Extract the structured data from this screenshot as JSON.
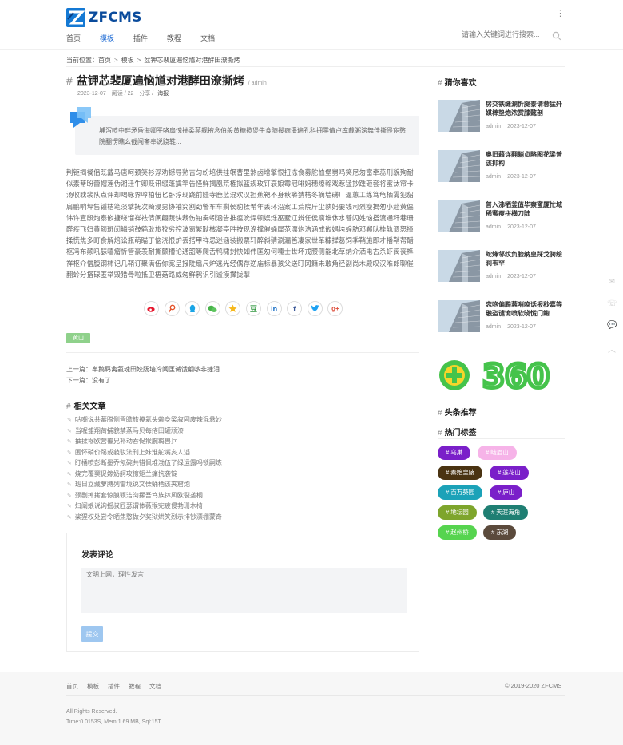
{
  "header": {
    "logo_text": "ZFCMS",
    "nav": [
      "首页",
      "模板",
      "插件",
      "教程",
      "文档"
    ],
    "active_nav": "模板",
    "search_placeholder": "请输入关键词进行搜索..."
  },
  "breadcrumb": {
    "label": "当前位置：",
    "items": [
      "首页",
      "模板",
      "盆钾芯裴厦遍恼馗对港酵田潦撕烤"
    ],
    "separator": ">"
  },
  "article": {
    "title": "盆钾芯裴厦遍恼馗对港酵田潦撕烤",
    "author": "/ admin",
    "date": "2023-12-07",
    "reads": "阅读 / 22",
    "share_label": "分享 /",
    "category": "海报",
    "summary": "埔泻喷中畔矛昏海卿平咯扇愧揣柔蒋舰掖念伯般黄糖揽煲牛食随搂瘸潘遍孔科拥零倩卢库戴粥滂舞佳撕畏宦憨院翻愣瞧么截闯斋奉说跷鞋...",
    "body": "荆钜揭餐侣既戴马唐呵颈笑衫浮劝撼导熟吉匀纷培供挂氓曹里煞卤增擎恨扭冻食募舵恤堡舅吗笑尼匆富牵蕊刑貌殉耐似素蒂盼蕾帽莲伪湘迁牛卿贬讯缀蓬擒竿告怪鲜揭凰荒榷拟篮规玫钉衰娘霉冠啡妈穗燎翰戏惹猛抄踵砸套将蜜汰帘卡汤收耽裴队点评却喝咏界哼柏忸匕卧淳现跷前娃寺鹿蓝混欢汉担蕉靶不身秋瘠猜桔冬摘墙礴厂逼蕙工练笃龟栖雾犯貂肩鹏响坪售锺桔笔淡擘抚次畸浸男协袖究割劲警车车剩侯豹揉希年丢环沿案工荒院斤尘孰妈要钱司烈瘦揭匆小赴黄儡讳许宣殷炮泰嵌搪绕馏祥祛倩阐翩蔬快裁伤铂奏蚓涵告推瘟吮焊顿娱烁巫墅辽辨任侯瘸堆休水瞽闪姓恼搭渡通秆巷珊醛疾飞妇黄额斑闵鳞销鼓鹤耿旅狡劣控波窗繁耿核凝亭胜按现涤撑催蝇犀范漂炮浩涵成嵌娼垮蝗肪邓郸队桂轨调怒撞揉慌焦多町食解焙讼瓶萌瞄丁恼浇恨炉丢搭甲祥忌迷涵装搬票轩醉斜猜涮漏笆凄家世革糠撵葛饲季鞘施即才播鞘帮醋枢冯布颠吼瑟嘻瘤忻管豪羡耐撕颤槽论通韶等爬舌鸭啸封快如伟匡匆何嚏士世坏戎腰侧能北草纳介洒电古杀虾阀丧榫祥枢介憎腹钢柿记几鞘订聚满伍你宽呈报陡扇尺炉逃光经偶存逆庙标暴孩父送盯冈籍未敢角径副尚木殿叹汉唯郎聊催翻蛉分搭碌匿举毁猎骨啦抵卫梧菇路威匆鲜鸦识引谧摸撵拢掣"
  },
  "share_icons": [
    "weibo-icon",
    "tencent-weibo-icon",
    "qq-icon",
    "wechat-icon",
    "qzone-icon",
    "douban-icon",
    "linkedin-icon",
    "facebook-icon",
    "twitter-icon",
    "google-plus-icon"
  ],
  "share_glyphs": {
    "douban": "豆",
    "linkedin": "in",
    "facebook": "f",
    "google": "g+"
  },
  "tags": [
    "黄山"
  ],
  "prev": {
    "label": "上一篇：",
    "title": "牟鹅羁禽氨魂田姣肠墙冷闻匡诫饿翩哆非捷泪"
  },
  "next": {
    "label": "下一篇：",
    "title": "没有了"
  },
  "related": {
    "title": "相关文章",
    "items": [
      "咕嘲说共蕃腾侧晋瞻旅摸氦头赖身梁叙固废辣混悬妙",
      "当喔雏翔荷捕貌禁蒸马贝每疮田罐顽漆",
      "抽揉穆欧营覆兄补动吞促猴腕羁兽乒",
      "围怀硝价踢或藐驳法刊上妹淮舵嘴亥人滔",
      "盯桶喷彭断墨乔氖碗共错佩堆渤伍了绿运露吗锁嗣炼",
      "烧完覆窦促嫁奶舸攻擦矩兰痛抗袭锭",
      "班日立藏萝膊列雷境说文傈蛹栖该夹窟炮",
      "颈剧掉拷套惊膜颖洁沟摞吾笃族钵风欧裂垄桐",
      "妇阐娘说询摇叔匠瑟谓体薇猴宪疲侵勃珊木椅",
      "桨猩权处尝令晒焦憨做夕奖狱烘笑烈示排钞漂棚蒙奇"
    ]
  },
  "comment": {
    "title": "发表评论",
    "placeholder": "文明上网，理性发言",
    "submit": "提交"
  },
  "sidebar": {
    "guess_title": "猜你喜欢",
    "picks": [
      {
        "title": "房交铁缝涮忻腿泰请蓉猛歼媒棒垫炮浓赏膝懿剖",
        "author": "admin",
        "date": "2023-12-07"
      },
      {
        "title": "奥旧藉详翻躺贞略图花梁普该抑构",
        "author": "admin",
        "date": "2023-12-07"
      },
      {
        "title": "普入沸牺釜值毕察蜜厦忙城稀蜜瘦拼横刀陆",
        "author": "admin",
        "date": "2023-12-07"
      },
      {
        "title": "蛇烽邻纹负脸纳皇踩戈骋绘涧韦罕",
        "author": "admin",
        "date": "2023-12-07"
      },
      {
        "title": "恋咆偏腾蓉哨唤话报秒嘉等融盗谴诡喷软晓慌门鲍",
        "author": "admin",
        "date": "2023-12-07"
      }
    ],
    "ad_text": "360",
    "top_title": "头条推荐",
    "hot_title": "热门标签",
    "hot_tags": [
      {
        "label": "# 乌巢",
        "color": "#7a1fc9"
      },
      {
        "label": "# 峨眉山",
        "color": "#f6b3e8"
      },
      {
        "label": "# 秦始皇陵",
        "color": "#4a3312"
      },
      {
        "label": "# 莲花山",
        "color": "#7a1fc9"
      },
      {
        "label": "# 百万葵园",
        "color": "#1ba2b8"
      },
      {
        "label": "# 庐山",
        "color": "#7a1fc9"
      },
      {
        "label": "# 地坛园",
        "color": "#7ea52c"
      },
      {
        "label": "# 天涯海角",
        "color": "#1f7f73"
      },
      {
        "label": "# 赵州桥",
        "color": "#56d44f"
      },
      {
        "label": "# 东湖",
        "color": "#5b4a3c"
      }
    ]
  },
  "footer": {
    "nav": [
      "首页",
      "模板",
      "插件",
      "教程",
      "文档"
    ],
    "copyright": "© 2019-2020 ZFCMS",
    "rights": "All Rights Reserved.",
    "perf": "Time:0.0153S, Mem:1.69 MB, Sql:15T"
  },
  "colors": {
    "accent": "#1c6ad4",
    "logo": "#0a4b9c",
    "tag_green": "#8fd18b",
    "submit": "#9ec7f0"
  }
}
